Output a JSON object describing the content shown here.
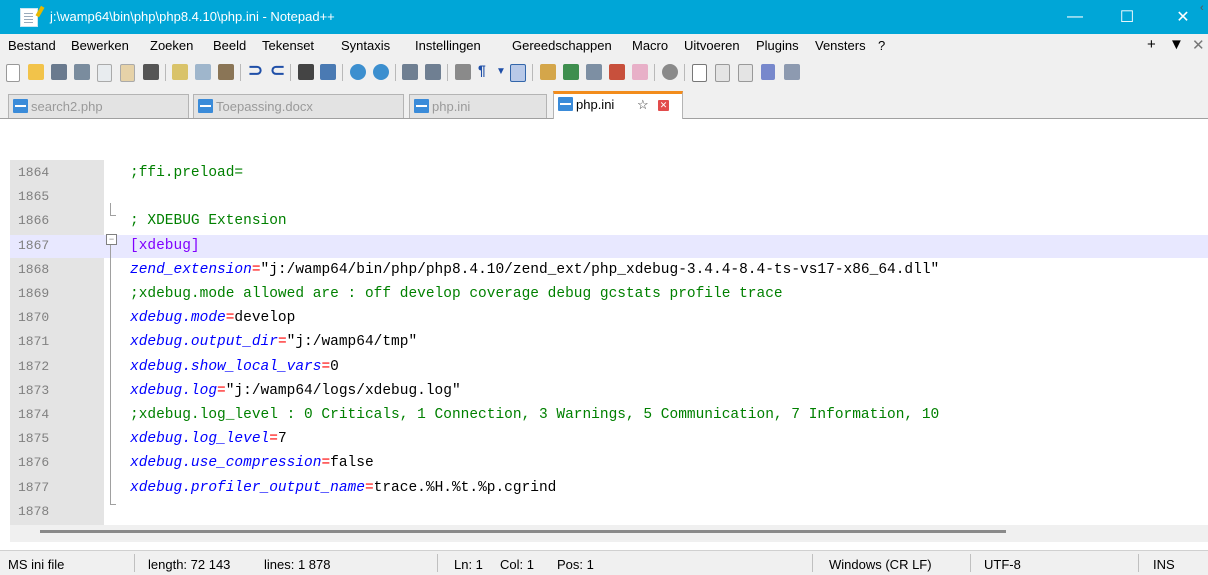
{
  "window": {
    "title": "j:\\wamp64\\bin\\php\\php8.4.10\\php.ini - Notepad++",
    "minimize": "—",
    "maximize": "☐",
    "close": "✕"
  },
  "menu": {
    "items": [
      "Bestand",
      "Bewerken",
      "Zoeken",
      "Beeld",
      "Tekenset",
      "Syntaxis",
      "Instellingen",
      "Gereedschappen",
      "Macro",
      "Uitvoeren",
      "Plugins",
      "Vensters",
      "?"
    ],
    "right": [
      "+",
      "▼",
      "✕"
    ]
  },
  "toolbar": {
    "icons": [
      "new-file-icon",
      "open-icon",
      "save-icon",
      "save-all-icon",
      "close-icon",
      "close-all-icon",
      "print-icon",
      "cut-icon",
      "copy-icon",
      "paste-icon",
      "undo-icon",
      "redo-icon",
      "find-icon",
      "replace-icon",
      "zoom-in-icon",
      "zoom-out-icon",
      "sync-v-icon",
      "sync-h-icon",
      "word-wrap-icon",
      "show-all-chars-icon",
      "indent-guide-icon",
      "lang-icon",
      "doc-map-icon",
      "function-list-icon",
      "folder-workspace-icon",
      "monitoring-icon",
      "record-macro-icon",
      "stop-macro-icon",
      "play-macro-icon",
      "run-macro-multiple-icon",
      "save-macro-icon"
    ]
  },
  "tabs": [
    {
      "label": "search2.php",
      "active": false
    },
    {
      "label": "Toepassing.docx",
      "active": false
    },
    {
      "label": "php.ini",
      "active": false
    },
    {
      "label": "php.ini",
      "active": true
    }
  ],
  "editor": {
    "lines": [
      {
        "num": "1864",
        "parts": [
          {
            "t": ";ffi.preload=",
            "c": "comment"
          }
        ]
      },
      {
        "num": "1865",
        "parts": []
      },
      {
        "num": "1866",
        "parts": [
          {
            "t": "; XDEBUG Extension",
            "c": "comment"
          }
        ]
      },
      {
        "num": "1867",
        "parts": [
          {
            "t": "[xdebug]",
            "c": "section"
          }
        ]
      },
      {
        "num": "1868",
        "parts": [
          {
            "t": "zend_extension",
            "c": "key"
          },
          {
            "t": "=",
            "c": "eq"
          },
          {
            "t": "\"j:/wamp64/bin/php/php8.4.10/zend_ext/php_xdebug-3.4.4-8.4-ts-vs17-x86_64.dll\"",
            "c": "val"
          }
        ]
      },
      {
        "num": "1869",
        "parts": [
          {
            "t": ";xdebug.mode allowed are : off develop coverage debug gcstats profile trace",
            "c": "comment"
          }
        ]
      },
      {
        "num": "1870",
        "parts": [
          {
            "t": "xdebug.mode",
            "c": "key"
          },
          {
            "t": "=",
            "c": "eq"
          },
          {
            "t": "develop",
            "c": "val"
          }
        ]
      },
      {
        "num": "1871",
        "parts": [
          {
            "t": "xdebug.output_dir",
            "c": "key"
          },
          {
            "t": "=",
            "c": "eq"
          },
          {
            "t": "\"j:/wamp64/tmp\"",
            "c": "val"
          }
        ]
      },
      {
        "num": "1872",
        "parts": [
          {
            "t": "xdebug.show_local_vars",
            "c": "key"
          },
          {
            "t": "=",
            "c": "eq"
          },
          {
            "t": "0",
            "c": "val"
          }
        ]
      },
      {
        "num": "1873",
        "parts": [
          {
            "t": "xdebug.log",
            "c": "key"
          },
          {
            "t": "=",
            "c": "eq"
          },
          {
            "t": "\"j:/wamp64/logs/xdebug.log\"",
            "c": "val"
          }
        ]
      },
      {
        "num": "1874",
        "parts": [
          {
            "t": ";xdebug.log_level : 0 Criticals, 1 Connection, 3 Warnings, 5 Communication, 7 Information, 10",
            "c": "comment"
          }
        ]
      },
      {
        "num": "1875",
        "parts": [
          {
            "t": "xdebug.log_level",
            "c": "key"
          },
          {
            "t": "=",
            "c": "eq"
          },
          {
            "t": "7",
            "c": "val"
          }
        ]
      },
      {
        "num": "1876",
        "parts": [
          {
            "t": "xdebug.use_compression",
            "c": "key"
          },
          {
            "t": "=",
            "c": "eq"
          },
          {
            "t": "false",
            "c": "val"
          }
        ]
      },
      {
        "num": "1877",
        "parts": [
          {
            "t": "xdebug.profiler_output_name",
            "c": "key"
          },
          {
            "t": "=",
            "c": "eq"
          },
          {
            "t": "trace.%H.%t.%p.cgrind",
            "c": "val"
          }
        ]
      },
      {
        "num": "1878",
        "parts": []
      }
    ],
    "current_line": "1867"
  },
  "status": {
    "file_type": "MS ini file",
    "length": "length: 72 143",
    "lines": "lines: 1 878",
    "ln": "Ln: 1",
    "col": "Col: 1",
    "pos": "Pos: 1",
    "eol": "Windows (CR LF)",
    "encoding": "UTF-8",
    "mode": "INS"
  },
  "colors": {
    "titlebar": "#00a6d7",
    "comment": "#008000",
    "section": "#8000ff",
    "key": "#0000ff",
    "operator": "#ff0000",
    "active_tab_accent": "#f28c1c"
  }
}
